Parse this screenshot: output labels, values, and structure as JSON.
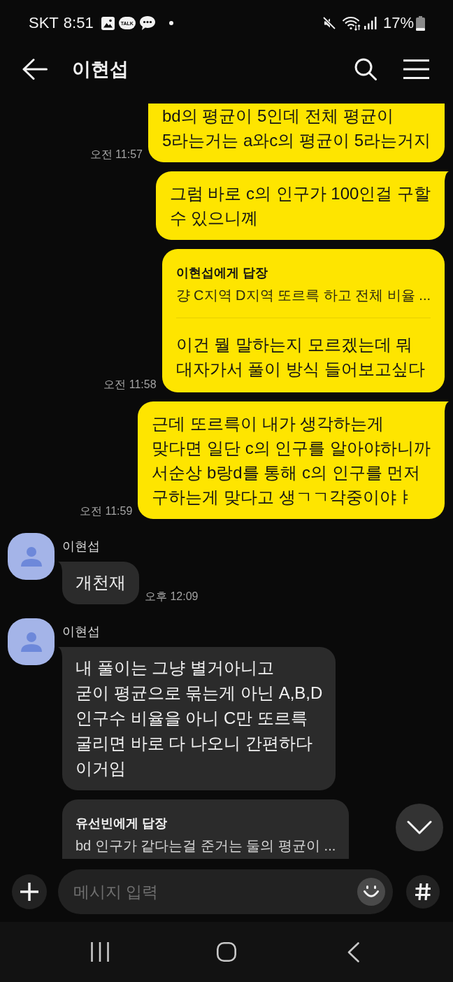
{
  "status_bar": {
    "carrier": "SKT",
    "time": "8:51",
    "notifications": [
      {
        "kind": "image"
      },
      {
        "kind": "talk",
        "label": "TALK"
      },
      {
        "kind": "chat"
      },
      {
        "kind": "dot"
      }
    ],
    "battery": "17%"
  },
  "header": {
    "title": "이현섭"
  },
  "messages": [
    {
      "kind": "outgoing",
      "tail": false,
      "text": "bd의 평균이 5인데 전체 평균이\n5라는거는 a와c의 평균이 5라는거지",
      "time": "오전 11:57"
    },
    {
      "kind": "outgoing",
      "tail": true,
      "text": "그럼 바로 c의 인구가 100인걸 구할\n수 있으니꼐"
    },
    {
      "kind": "outgoing",
      "tail": false,
      "reply": {
        "title": "이현섭에게 답장",
        "quote": "걍 C지역 D지역 또르륵 하고 전체 비율 ..."
      },
      "text": "이건 뭘 말하는지 모르겠는데 뭐\n대자가서 풀이 방식 들어보고싶다",
      "time": "오전 11:58"
    },
    {
      "kind": "outgoing",
      "tail": true,
      "text": "근데 또르륵이 내가 생각하는게\n맞다면 일단 c의 인구를 알아야하니까\n서순상 b랑d를 통해 c의 인구를 먼저\n구하는게 맞다고 생ㄱㄱ각중이야ㅑ",
      "time": "오전 11:59"
    },
    {
      "kind": "incoming",
      "sender": "이현섭",
      "tail": true,
      "text": "개천재",
      "time": "오후 12:09"
    },
    {
      "kind": "incoming",
      "sender": "이현섭",
      "tail": true,
      "text": "내 풀이는 그냥 별거아니고\n굳이 평균으로 묶는게 아닌 A,B,D\n인구수 비율을 아니 C만 또르륵\n굴리면 바로 다 나오니 간편하다\n이거임"
    },
    {
      "kind": "incoming",
      "tail": false,
      "reply": {
        "title": "유선빈에게 답장",
        "quote": "bd 인구가 같다는걸 준거는 둘의 평균이 ..."
      }
    }
  ],
  "composer": {
    "placeholder": "메시지 입력"
  }
}
